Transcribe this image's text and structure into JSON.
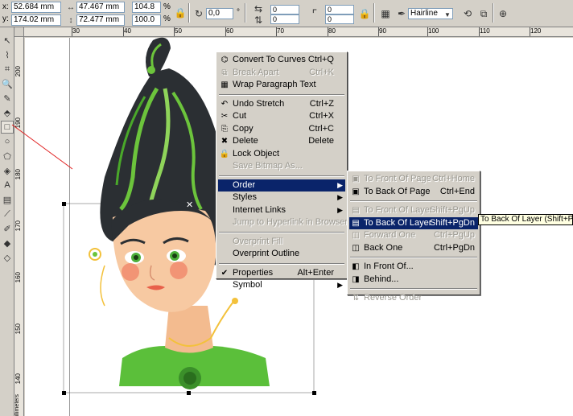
{
  "propbar": {
    "x": "52.684 mm",
    "y": "174.02 mm",
    "width": "47.467 mm",
    "height": "72.477 mm",
    "scale_x": "104.8",
    "scale_y": "100.0",
    "percent": "%",
    "rotation": "0,0",
    "degree": "°",
    "nudge_a": "0",
    "nudge_b": "0",
    "nudge_c": "0",
    "nudge_d": "0",
    "outline": "Hairline",
    "x_label": "x:",
    "y_label": "y:"
  },
  "ruler": {
    "h_ticks": [
      "30",
      "40",
      "50",
      "60",
      "70",
      "80",
      "90",
      "100",
      "110",
      "120"
    ],
    "v_ticks": [
      "200",
      "190",
      "180",
      "170",
      "160",
      "150",
      "140"
    ],
    "unit": "millimeters"
  },
  "context_menu": {
    "items": [
      {
        "label": "Convert To Curves",
        "shortcut": "Ctrl+Q",
        "icon": "convert-curves-icon",
        "disabled": false
      },
      {
        "label": "Break Apart",
        "shortcut": "Ctrl+K",
        "icon": "break-apart-icon",
        "disabled": true
      },
      {
        "label": "Wrap Paragraph Text",
        "shortcut": "",
        "icon": "wrap-text-icon",
        "disabled": false
      },
      {
        "label": "Undo Stretch",
        "shortcut": "Ctrl+Z",
        "icon": "undo-icon",
        "disabled": false
      },
      {
        "label": "Cut",
        "shortcut": "Ctrl+X",
        "icon": "cut-icon",
        "disabled": false
      },
      {
        "label": "Copy",
        "shortcut": "Ctrl+C",
        "icon": "copy-icon",
        "disabled": false
      },
      {
        "label": "Delete",
        "shortcut": "Delete",
        "icon": "delete-icon",
        "disabled": false
      },
      {
        "label": "Lock Object",
        "shortcut": "",
        "icon": "lock-icon",
        "disabled": false
      },
      {
        "label": "Save Bitmap As...",
        "shortcut": "",
        "icon": "",
        "disabled": true
      },
      {
        "label": "Order",
        "shortcut": "",
        "icon": "",
        "disabled": false,
        "submenu": true,
        "highlighted": true
      },
      {
        "label": "Styles",
        "shortcut": "",
        "icon": "",
        "disabled": false,
        "submenu": true
      },
      {
        "label": "Internet Links",
        "shortcut": "",
        "icon": "",
        "disabled": false,
        "submenu": true
      },
      {
        "label": "Jump to Hyperlink in Browser",
        "shortcut": "",
        "icon": "",
        "disabled": true
      },
      {
        "label": "Overprint Fill",
        "shortcut": "",
        "icon": "",
        "disabled": true
      },
      {
        "label": "Overprint Outline",
        "shortcut": "",
        "icon": "",
        "disabled": false
      },
      {
        "label": "Properties",
        "shortcut": "Alt+Enter",
        "icon": "check-icon",
        "disabled": false
      },
      {
        "label": "Symbol",
        "shortcut": "",
        "icon": "",
        "disabled": false,
        "submenu": true
      }
    ]
  },
  "order_submenu": {
    "items": [
      {
        "label": "To Front Of Page",
        "shortcut": "Ctrl+Home",
        "disabled": true
      },
      {
        "label": "To Back Of Page",
        "shortcut": "Ctrl+End",
        "disabled": false
      },
      {
        "label": "To Front Of Layer",
        "shortcut": "Shift+PgUp",
        "disabled": true
      },
      {
        "label": "To Back Of Layer",
        "shortcut": "Shift+PgDn",
        "disabled": false,
        "highlighted": true
      },
      {
        "label": "Forward One",
        "shortcut": "Ctrl+PgUp",
        "disabled": true
      },
      {
        "label": "Back One",
        "shortcut": "Ctrl+PgDn",
        "disabled": false
      },
      {
        "label": "In Front Of...",
        "shortcut": "",
        "disabled": false
      },
      {
        "label": "Behind...",
        "shortcut": "",
        "disabled": false
      },
      {
        "label": "Reverse Order",
        "shortcut": "",
        "disabled": true
      }
    ]
  },
  "tooltip": "To Back Of Layer (Shift+PgDn)",
  "colors": {
    "hair": "#2b2f33",
    "hair_green": "#6cc43c",
    "skin": "#f7c9a2",
    "shirt": "#5bbf3a",
    "menu_bg": "#d4d0c8",
    "highlight": "#0a246a"
  }
}
